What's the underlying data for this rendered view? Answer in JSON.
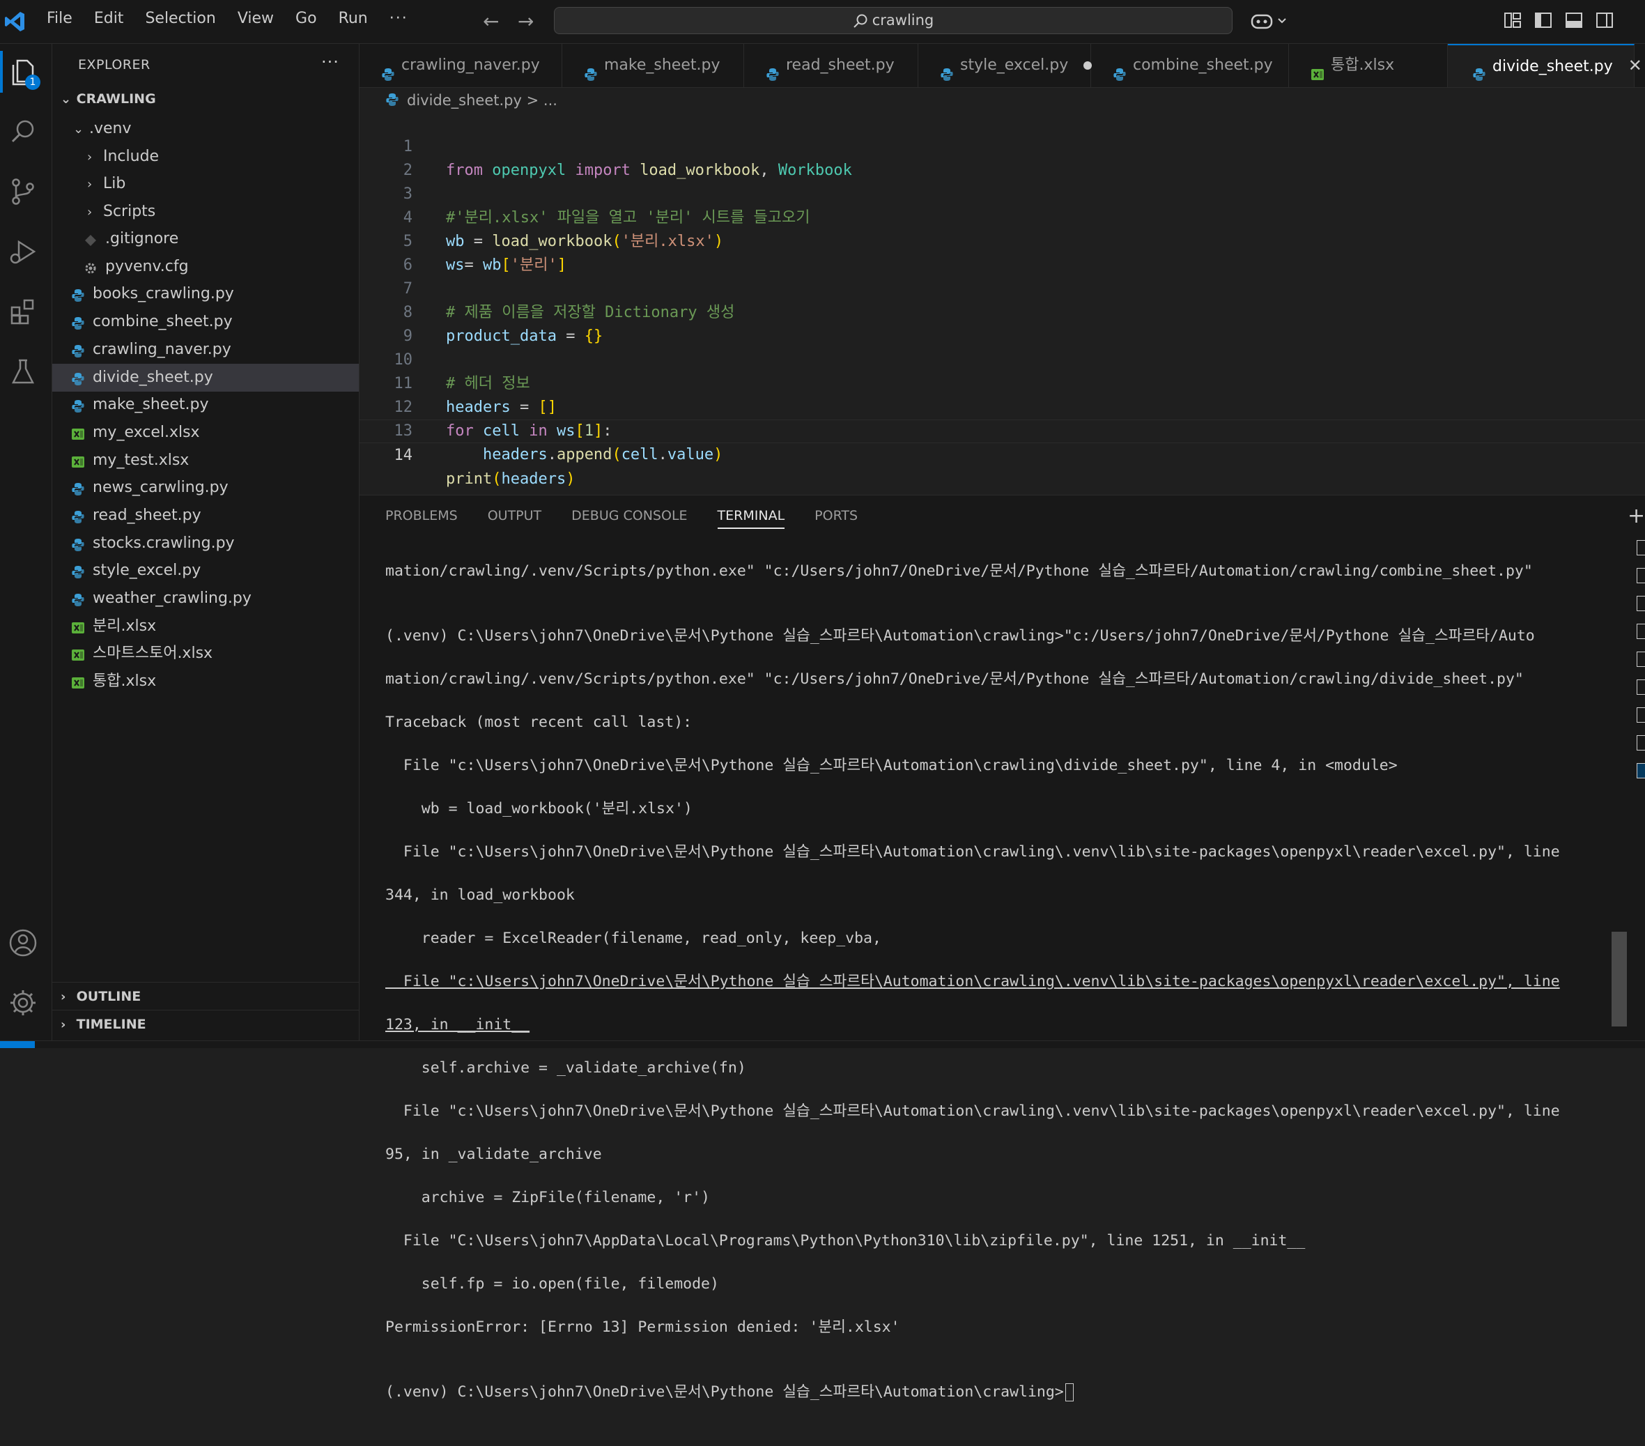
{
  "menu": [
    "File",
    "Edit",
    "Selection",
    "View",
    "Go",
    "Run",
    "···"
  ],
  "search": {
    "value": "crawling"
  },
  "activity": {
    "explorer_badge": "1"
  },
  "explorer": {
    "title": "EXPLORER",
    "more": "···",
    "root": "CRAWLING",
    "items": [
      {
        "label": ".venv"
      },
      {
        "label": "Include"
      },
      {
        "label": "Lib"
      },
      {
        "label": "Scripts"
      },
      {
        "label": ".gitignore"
      },
      {
        "label": "pyvenv.cfg"
      },
      {
        "label": "books_crawling.py"
      },
      {
        "label": "combine_sheet.py"
      },
      {
        "label": "crawling_naver.py"
      },
      {
        "label": "divide_sheet.py"
      },
      {
        "label": "make_sheet.py"
      },
      {
        "label": "my_excel.xlsx"
      },
      {
        "label": "my_test.xlsx"
      },
      {
        "label": "news_carwling.py"
      },
      {
        "label": "read_sheet.py"
      },
      {
        "label": "stocks.crawling.py"
      },
      {
        "label": "style_excel.py"
      },
      {
        "label": "weather_crawling.py"
      },
      {
        "label": "분리.xlsx"
      },
      {
        "label": "스마트스토어.xlsx"
      },
      {
        "label": "통합.xlsx"
      }
    ],
    "outline": "OUTLINE",
    "timeline": "TIMELINE"
  },
  "tabs": [
    {
      "label": "crawling_naver.py"
    },
    {
      "label": "make_sheet.py"
    },
    {
      "label": "read_sheet.py"
    },
    {
      "label": "style_excel.py"
    },
    {
      "label": "combine_sheet.py"
    },
    {
      "label": "통합.xlsx"
    },
    {
      "label": "divide_sheet.py"
    }
  ],
  "breadcrumb": {
    "file": "divide_sheet.py",
    "rest": "> ..."
  },
  "code": {
    "numbers": [
      "1",
      "2",
      "3",
      "4",
      "5",
      "6",
      "7",
      "8",
      "9",
      "10",
      "11",
      "12",
      "13",
      "14"
    ],
    "l1": [
      "from",
      " ",
      "openpyxl",
      " ",
      "import",
      " ",
      "load_workbook",
      ", ",
      "Workbook"
    ],
    "l3": "#'분리.xlsx' 파일을 열고 '분리' 시트를 들고오기",
    "l4": [
      "wb",
      " = ",
      "load_workbook",
      "(",
      "'분리.xlsx'",
      ")"
    ],
    "l5": [
      "ws",
      "= ",
      "wb",
      "[",
      "'분리'",
      "]"
    ],
    "l7": "# 제품 이름을 저장할 Dictionary 생성",
    "l8": [
      "product_data",
      " = ",
      "{}"
    ],
    "l10": "# 헤더 정보",
    "l11": [
      "headers",
      " = ",
      "[]"
    ],
    "l12": [
      "for",
      " ",
      "cell",
      " ",
      "in",
      " ",
      "ws",
      "[",
      "1",
      "]",
      ":"
    ],
    "l13": [
      "    ",
      "headers",
      ".",
      "append",
      "(",
      "cell",
      ".",
      "value",
      ")"
    ],
    "l14": [
      "print",
      "(",
      "headers",
      ")"
    ]
  },
  "panel": {
    "tabs": [
      "PROBLEMS",
      "OUTPUT",
      "DEBUG CONSOLE",
      "TERMINAL",
      "PORTS"
    ],
    "plus": "+",
    "terminal": [
      "mation/crawling/.venv/Scripts/python.exe\" \"c:/Users/john7/OneDrive/문서/Pythone 실습_스파르타/Automation/crawling/combine_sheet.py\"",
      "",
      "(.venv) C:\\Users\\john7\\OneDrive\\문서\\Pythone 실습_스파르타\\Automation\\crawling>\"c:/Users/john7/OneDrive/문서/Pythone 실습_스파르타/Auto",
      "mation/crawling/.venv/Scripts/python.exe\" \"c:/Users/john7/OneDrive/문서/Pythone 실습_스파르타/Automation/crawling/divide_sheet.py\"",
      "Traceback (most recent call last):",
      "  File \"c:\\Users\\john7\\OneDrive\\문서\\Pythone 실습_스파르타\\Automation\\crawling\\divide_sheet.py\", line 4, in <module>",
      "    wb = load_workbook('분리.xlsx')",
      "  File \"c:\\Users\\john7\\OneDrive\\문서\\Pythone 실습_스파르타\\Automation\\crawling\\.venv\\lib\\site-packages\\openpyxl\\reader\\excel.py\", line",
      "344, in load_workbook",
      "    reader = ExcelReader(filename, read_only, keep_vba,",
      "  File \"c:\\Users\\john7\\OneDrive\\문서\\Pythone 실습 스파르타\\Automation\\crawling\\.venv\\lib\\site-packages\\openpyxl\\reader\\excel.py\", line",
      "123, in __init__",
      "    self.archive = _validate_archive(fn)",
      "  File \"c:\\Users\\john7\\OneDrive\\문서\\Pythone 실습_스파르타\\Automation\\crawling\\.venv\\lib\\site-packages\\openpyxl\\reader\\excel.py\", line",
      "95, in _validate_archive",
      "    archive = ZipFile(filename, 'r')",
      "  File \"C:\\Users\\john7\\AppData\\Local\\Programs\\Python\\Python310\\lib\\zipfile.py\", line 1251, in __init__",
      "    self.fp = io.open(file, filemode)",
      "PermissionError: [Errno 13] Permission denied: '분리.xlsx'",
      "",
      "(.venv) C:\\Users\\john7\\OneDrive\\문서\\Pythone 실습_스파르타\\Automation\\crawling>"
    ]
  },
  "colors": {
    "accent": "#0078d4",
    "python_icon": "#3c9fd6",
    "excel_icon": "#5bb03a"
  }
}
